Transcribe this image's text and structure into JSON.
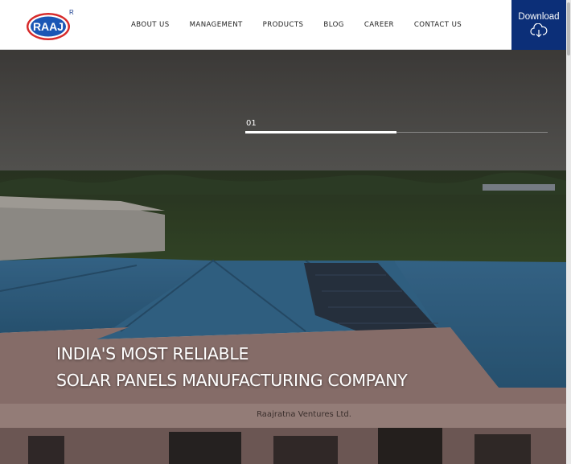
{
  "brand": {
    "logo_text": "RAAJ",
    "registered_mark": "R",
    "colors": {
      "primary": "#0c2f78",
      "logo_red": "#d62a2a",
      "logo_blue": "#1a56b5"
    }
  },
  "nav": {
    "items": [
      {
        "label": "ABOUT US"
      },
      {
        "label": "MANAGEMENT"
      },
      {
        "label": "PRODUCTS"
      },
      {
        "label": "BLOG"
      },
      {
        "label": "CAREER"
      },
      {
        "label": "CONTACT US"
      }
    ]
  },
  "download": {
    "label": "Download",
    "icon": "cloud-download-icon"
  },
  "hero": {
    "slide_number": "01",
    "slide_progress": 0.5,
    "headline_line1": "INDIA'S MOST RELIABLE",
    "headline_line2": "SOLAR PANELS MANUFACTURING COMPANY",
    "building_sign": "Raajratna Ventures Ltd."
  }
}
